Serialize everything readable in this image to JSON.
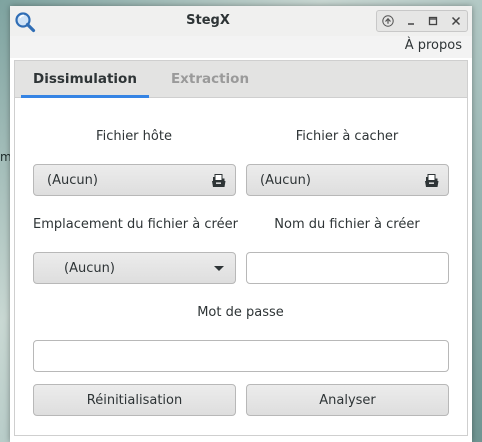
{
  "window": {
    "title": "StegX",
    "app_icon": "magnifier-icon",
    "controls": [
      "up-arrow-icon",
      "minimize-icon",
      "maximize-icon",
      "close-icon"
    ]
  },
  "background_fragment": "m",
  "menu": {
    "about_label": "À propos"
  },
  "tabs": [
    {
      "label": "Dissimulation",
      "active": true
    },
    {
      "label": "Extraction",
      "active": false
    }
  ],
  "form": {
    "host_file": {
      "label": "Fichier hôte",
      "value": "(Aucun)",
      "icon": "open-file-icon"
    },
    "hide_file": {
      "label": "Fichier à cacher",
      "value": "(Aucun)",
      "icon": "open-file-icon"
    },
    "output_location": {
      "label": "Emplacement du fichier à créer",
      "value": "(Aucun)",
      "icon": "chevron-down-icon"
    },
    "output_name": {
      "label": "Nom du fichier à créer",
      "value": "",
      "placeholder": ""
    },
    "password": {
      "label": "Mot de passe",
      "value": "",
      "placeholder": ""
    }
  },
  "actions": {
    "reset_label": "Réinitialisation",
    "analyze_label": "Analyser"
  },
  "colors": {
    "accent": "#3584e4",
    "inactive_tab": "#9a9a9a",
    "text": "#2e3436"
  }
}
